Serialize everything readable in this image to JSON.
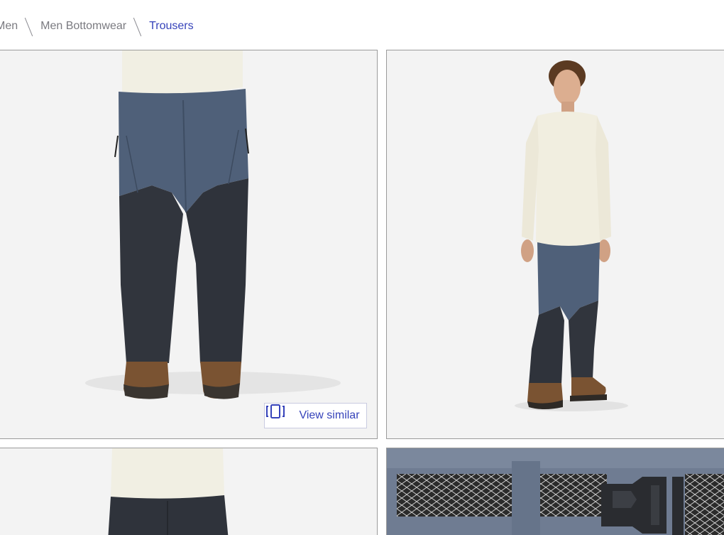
{
  "breadcrumb": {
    "items": [
      {
        "label": "Men"
      },
      {
        "label": "Men Bottomwear"
      },
      {
        "label": "Trousers"
      }
    ]
  },
  "gallery": {
    "view_similar_label": "View similar",
    "view_similar_icon": "cards-stack-icon",
    "accent_color": "#3643ba",
    "tiles": [
      {
        "subject": "trousers-front-closeup"
      },
      {
        "subject": "model-full-body"
      },
      {
        "subject": "trousers-back-closeup"
      },
      {
        "subject": "belt-buckle-detail"
      }
    ]
  }
}
